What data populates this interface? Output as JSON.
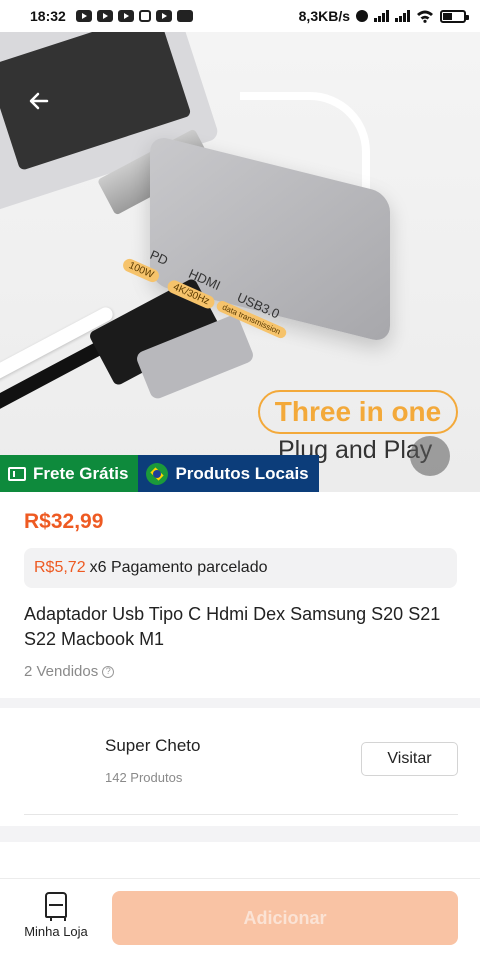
{
  "status_bar": {
    "time": "18:32",
    "network_speed": "8,3KB/s",
    "icons": [
      "youtube-icon",
      "youtube-icon",
      "youtube-icon",
      "people-icon",
      "youtube-icon",
      "video-icon",
      "alarm-icon",
      "signal-icon",
      "signal-icon",
      "wifi-icon",
      "battery-icon"
    ]
  },
  "hero_image": {
    "port_labels": [
      "PD",
      "HDMI",
      "USB3.0"
    ],
    "port_tags": [
      "100W",
      "4K/30Hz",
      "data transmission"
    ],
    "slogan_line1": "Three in one",
    "slogan_line2": "Plug and Play"
  },
  "badges": {
    "shipping": "Frete Grátis",
    "local": "Produtos Locais"
  },
  "product": {
    "price": "R$32,99",
    "installment_price": "R$5,72",
    "installment_text": "x6 Pagamento parcelado",
    "title": "Adaptador Usb Tipo C Hdmi Dex Samsung S20 S21 S22 Macbook M1",
    "sold": "2 Vendidos"
  },
  "store": {
    "name": "Super Cheto",
    "products": "142 Produtos",
    "visit_label": "Visitar"
  },
  "bottom_bar": {
    "store_tab_label": "Minha Loja",
    "add_label": "Adicionar"
  },
  "colors": {
    "accent": "#ee5a22",
    "shipping_badge": "#0e8a3c",
    "local_badge": "#0c3d7a",
    "add_button": "#f9c3a4"
  }
}
